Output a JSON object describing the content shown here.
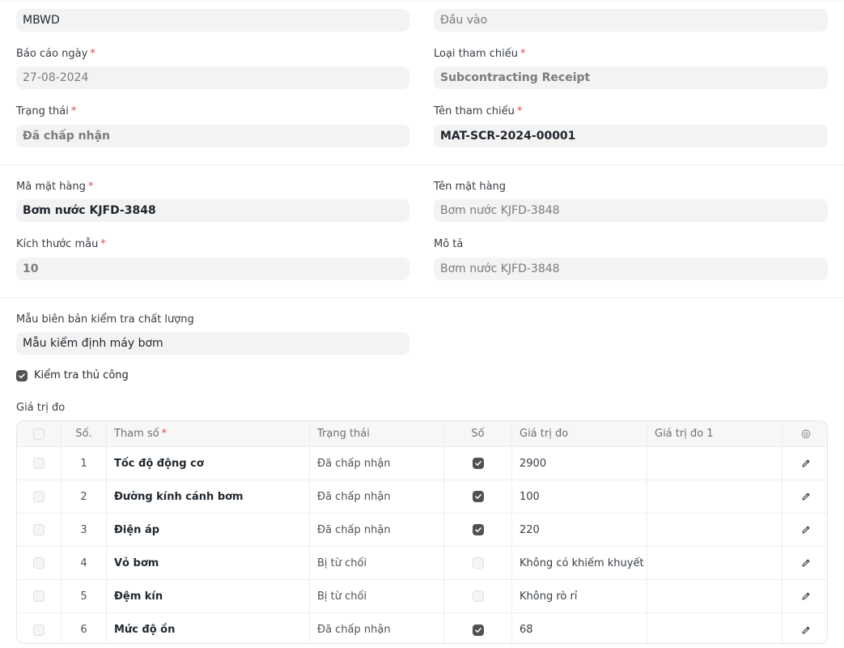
{
  "top_fields": {
    "left_value": "MBWD",
    "right_value": "Đầu vào"
  },
  "report_date": {
    "label": "Báo cáo ngày",
    "value": "27-08-2024"
  },
  "reference_type": {
    "label": "Loại tham chiếu",
    "value": "Subcontracting Receipt"
  },
  "status": {
    "label": "Trạng thái",
    "value": "Đã chấp nhận"
  },
  "reference_name": {
    "label": "Tên tham chiếu",
    "value": "MAT-SCR-2024-00001"
  },
  "item_code": {
    "label": "Mã mặt hàng",
    "value": "Bơm nước KJFD-3848"
  },
  "item_name": {
    "label": "Tên mặt hàng",
    "value": "Bơm nước KJFD-3848"
  },
  "sample_size": {
    "label": "Kích thước mẫu",
    "value": "10"
  },
  "description": {
    "label": "Mô tả",
    "value": "Bơm nước KJFD-3848"
  },
  "template": {
    "label": "Mẫu biên bản kiểm tra chất lượng",
    "value": "Mẫu kiểm định máy bơm"
  },
  "manual_inspection": {
    "label": "Kiểm tra thủ công",
    "checked": true
  },
  "readings": {
    "section_label": "Giá trị đo",
    "columns": {
      "no": "Số.",
      "parameter": "Tham số",
      "status": "Trạng thái",
      "numeric": "Số",
      "reading_value": "Giá trị đo",
      "reading_1": "Giá trị đo 1"
    },
    "rows": [
      {
        "no": "1",
        "parameter": "Tốc độ động cơ",
        "status": "Đã chấp nhận",
        "numeric": true,
        "reading_value": "2900",
        "reading_1": ""
      },
      {
        "no": "2",
        "parameter": "Đường kính cánh bơm",
        "status": "Đã chấp nhận",
        "numeric": true,
        "reading_value": "100",
        "reading_1": ""
      },
      {
        "no": "3",
        "parameter": "Điện áp",
        "status": "Đã chấp nhận",
        "numeric": true,
        "reading_value": "220",
        "reading_1": ""
      },
      {
        "no": "4",
        "parameter": "Vỏ bơm",
        "status": "Bị từ chối",
        "numeric": false,
        "reading_value": "Không có khiếm khuyết",
        "reading_1": ""
      },
      {
        "no": "5",
        "parameter": "Đệm kín",
        "status": "Bị từ chối",
        "numeric": false,
        "reading_value": "Không rò rỉ",
        "reading_1": ""
      },
      {
        "no": "6",
        "parameter": "Mức độ ồn",
        "status": "Đã chấp nhận",
        "numeric": true,
        "reading_value": "68",
        "reading_1": ""
      }
    ]
  },
  "colors": {
    "field_bg": "#f3f3f3",
    "required": "#e24c4c",
    "checkbox_on": "#525252",
    "border": "#ebeef0"
  },
  "icons": {
    "row_edit": "pencil-icon",
    "grid_settings": "gear-icon",
    "checkmark": "check-icon"
  }
}
